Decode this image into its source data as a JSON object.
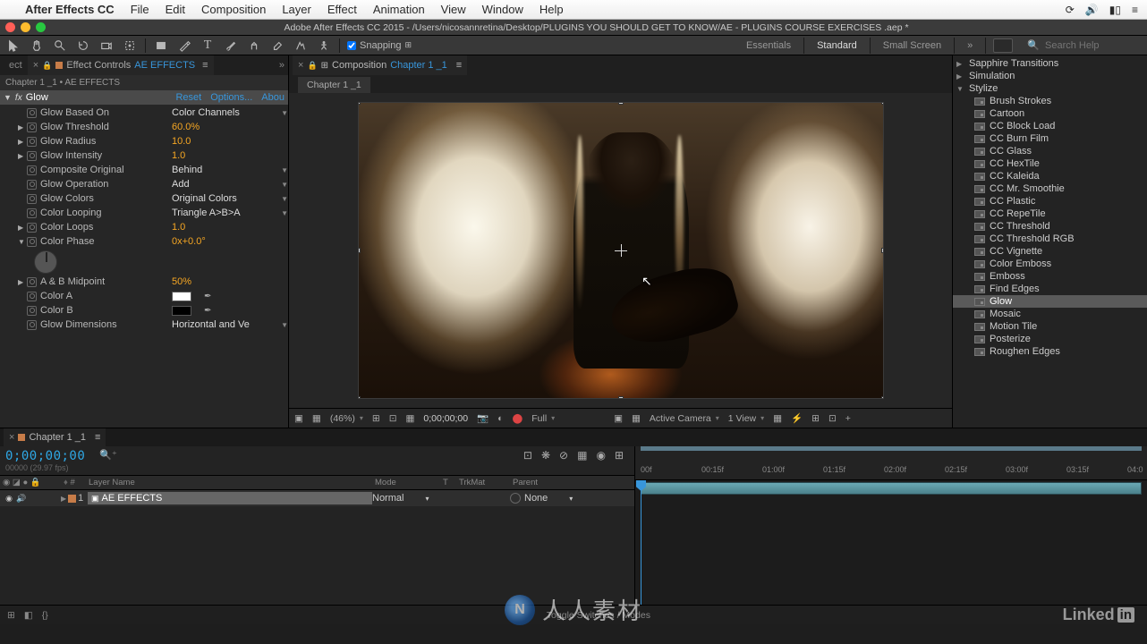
{
  "mac_menu": {
    "app": "After Effects CC",
    "items": [
      "File",
      "Edit",
      "Composition",
      "Layer",
      "Effect",
      "Animation",
      "View",
      "Window",
      "Help"
    ]
  },
  "title": "Adobe After Effects CC 2015 - /Users/nicosannretina/Desktop/PLUGINS YOU SHOULD GET  TO KNOW/AE - PLUGINS COURSE EXERCISES .aep *",
  "toolbar": {
    "snapping": "Snapping"
  },
  "workspaces": {
    "items": [
      "Essentials",
      "Standard",
      "Small Screen"
    ],
    "active": 1
  },
  "search": {
    "placeholder": "Search Help"
  },
  "ec": {
    "tab": "Effect Controls",
    "layer": "AE EFFECTS",
    "breadcrumb": "Chapter 1 _1 • AE EFFECTS",
    "effect": "Glow",
    "links": {
      "reset": "Reset",
      "options": "Options...",
      "about": "Abou"
    },
    "props": [
      {
        "label": "Glow Based On",
        "val": "Color Channels",
        "dd": true
      },
      {
        "label": "Glow Threshold",
        "val": "60.0%"
      },
      {
        "label": "Glow Radius",
        "val": "10.0"
      },
      {
        "label": "Glow Intensity",
        "val": "1.0"
      },
      {
        "label": "Composite Original",
        "val": "Behind",
        "dd": true
      },
      {
        "label": "Glow Operation",
        "val": "Add",
        "dd": true
      },
      {
        "label": "Glow Colors",
        "val": "Original Colors",
        "dd": true
      },
      {
        "label": "Color Looping",
        "val": "Triangle A>B>A",
        "dd": true
      },
      {
        "label": "Color Loops",
        "val": "1.0"
      },
      {
        "label": "Color Phase",
        "val": "0x+0.0°",
        "dial": true
      },
      {
        "label": "A & B Midpoint",
        "val": "50%"
      },
      {
        "label": "Color A",
        "swatch": "white"
      },
      {
        "label": "Color B",
        "swatch": "black"
      },
      {
        "label": "Glow Dimensions",
        "val": "Horizontal and Ve",
        "dd": true
      }
    ]
  },
  "comp": {
    "tab": "Composition",
    "name": "Chapter 1 _1",
    "subtab": "Chapter 1 _1",
    "footer": {
      "mag": "(46%)",
      "time": "0;00;00;00",
      "res": "Full",
      "camera": "Active Camera",
      "views": "1 View"
    }
  },
  "fx_browser": {
    "categories": [
      {
        "name": "Sapphire Transitions",
        "open": false
      },
      {
        "name": "Simulation",
        "open": false
      },
      {
        "name": "Stylize",
        "open": true,
        "items": [
          "Brush Strokes",
          "Cartoon",
          "CC Block Load",
          "CC Burn Film",
          "CC Glass",
          "CC HexTile",
          "CC Kaleida",
          "CC Mr. Smoothie",
          "CC Plastic",
          "CC RepeTile",
          "CC Threshold",
          "CC Threshold RGB",
          "CC Vignette",
          "Color Emboss",
          "Emboss",
          "Find Edges",
          "Glow",
          "Mosaic",
          "Motion Tile",
          "Posterize",
          "Roughen Edges"
        ]
      }
    ],
    "selected": "Glow"
  },
  "timeline": {
    "tab": "Chapter 1 _1",
    "timecode": "0;00;00;00",
    "fps": "00000 (29.97 fps)",
    "cols": {
      "num": "#",
      "layer": "Layer Name",
      "mode": "Mode",
      "t": "T",
      "trk": "TrkMat",
      "parent": "Parent"
    },
    "layer": {
      "num": "1",
      "name": "AE EFFECTS",
      "mode": "Normal",
      "parent": "None"
    },
    "ruler": [
      "00f",
      "00:15f",
      "01:00f",
      "01:15f",
      "02:00f",
      "02:15f",
      "03:00f",
      "03:15f",
      "04:0"
    ],
    "toggle": "Toggle Switches / Modes"
  },
  "watermark": "人人素材"
}
